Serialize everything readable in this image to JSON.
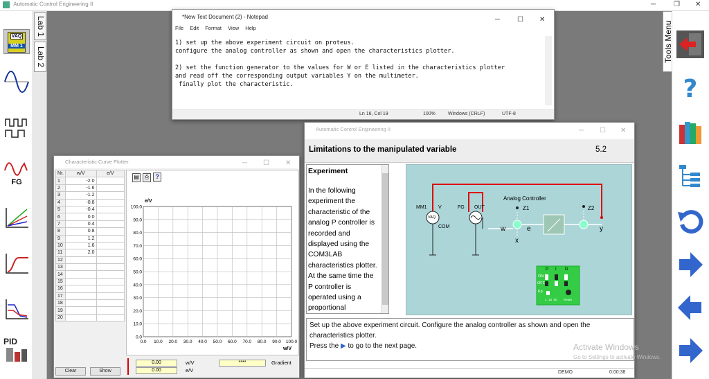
{
  "app": {
    "title": "Automatic Control Engineering II",
    "lab_tabs": [
      "Lab 1",
      "Lab 2"
    ],
    "tools_menu": "Tools Menu",
    "left_icons": [
      {
        "name": "multimeter",
        "label": "MM 1",
        "sub": "VAQ"
      },
      {
        "name": "sine-wave"
      },
      {
        "name": "square-wave"
      },
      {
        "name": "function-generator",
        "label": "FG"
      },
      {
        "name": "characteristic-plotter"
      },
      {
        "name": "step-response"
      },
      {
        "name": "bode-plot"
      },
      {
        "name": "pid-controller",
        "label": "PID"
      }
    ],
    "right_icons": [
      "exit-icon",
      "help-icon",
      "books-icon",
      "hierarchy-icon",
      "back-circle-icon",
      "next-arrow-icon",
      "prev-arrow-icon",
      "forward-arrow-icon"
    ]
  },
  "notepad": {
    "title": "*New Text Document (2) - Notepad",
    "menu": [
      "File",
      "Edit",
      "Format",
      "View",
      "Help"
    ],
    "lines": [
      "1) set up the above experiment circuit on proteus.",
      "configure the analog controller as shown and open the characteristics plotter.",
      "",
      "2) set the function generator to the values for W or E listed in the characteristics plotter",
      "and read off the corresponding output variables Y on the multimeter.",
      " finally plot the characteristic."
    ],
    "status": {
      "position": "Ln 16, Col 19",
      "zoom": "100%",
      "eol": "Windows (CRLF)",
      "encoding": "UTF-8"
    }
  },
  "plotter": {
    "title": "Characteristic Curve Plotter",
    "columns": [
      "Nr.",
      "w/V",
      "e/V"
    ],
    "rows": [
      [
        "1",
        "-2.0",
        ""
      ],
      [
        "2",
        "-1.6",
        ""
      ],
      [
        "3",
        "-1.2",
        ""
      ],
      [
        "4",
        "-0.8",
        ""
      ],
      [
        "5",
        "-0.4",
        ""
      ],
      [
        "6",
        "0.0",
        ""
      ],
      [
        "7",
        "0.4",
        ""
      ],
      [
        "8",
        "0.8",
        ""
      ],
      [
        "9",
        "1.2",
        ""
      ],
      [
        "10",
        "1.6",
        ""
      ],
      [
        "11",
        "2.0",
        ""
      ],
      [
        "12",
        "",
        ""
      ],
      [
        "13",
        "",
        ""
      ],
      [
        "14",
        "",
        ""
      ],
      [
        "15",
        "",
        ""
      ],
      [
        "16",
        "",
        ""
      ],
      [
        "17",
        "",
        ""
      ],
      [
        "18",
        "",
        ""
      ],
      [
        "19",
        "",
        ""
      ],
      [
        "20",
        "",
        ""
      ]
    ],
    "ylabel": "e/V",
    "xlabel": "w/V",
    "yticks": [
      "100.0",
      "90.0",
      "80.0",
      "70.0",
      "60.0",
      "50.0",
      "40.0",
      "30.0",
      "20.0",
      "10.0",
      "0.0"
    ],
    "xticks": [
      "0.0",
      "10.0",
      "20.0",
      "30.0",
      "40.0",
      "50.0",
      "60.0",
      "70.0",
      "80.0",
      "90.0",
      "100.0"
    ],
    "values": {
      "w": "0.00",
      "e": "0.00",
      "w_unit": "w/V",
      "e_unit": "e/V",
      "gradient_value": "****",
      "gradient_label": "Gradient"
    },
    "buttons": {
      "clear": "Clear",
      "show": "Show"
    }
  },
  "main": {
    "title": "Automatic Control Engineering II",
    "heading": "Limitations to the manipulated variable",
    "page": "5.2",
    "experiment_title": "Experiment",
    "experiment_text": "In the following experiment the characteristic of the analog P controller is recorded and displayed using the COM3LAB characteristics plotter. At the same time the P controller is operated using a proportional",
    "instructions_1": "Set up the above experiment circuit. Configure the analog controller as shown and open the characteristics plotter.",
    "instructions_2a": "Press the",
    "instructions_2b": "to go to the next page.",
    "status": {
      "mode": "DEMO",
      "time": "0:00:38"
    },
    "diagram": {
      "controller_label": "Analog Controller",
      "mm_label": "MM1",
      "v": "V",
      "com": "COM",
      "vaq": "VAQ",
      "fg": "FG",
      "out": "OUT",
      "z1": "Z1",
      "z2": "Z2",
      "w": "w",
      "e": "e",
      "x": "x",
      "y": "y",
      "pid": [
        "P",
        "I",
        "D"
      ],
      "on": "ON",
      "off": "OFF",
      "kp": "Kp",
      "kp_scale": "1  10  50",
      "reset": "Reset"
    }
  },
  "activate": {
    "line1": "Activate Windows",
    "line2": "Go to Settings to activate Windows."
  }
}
